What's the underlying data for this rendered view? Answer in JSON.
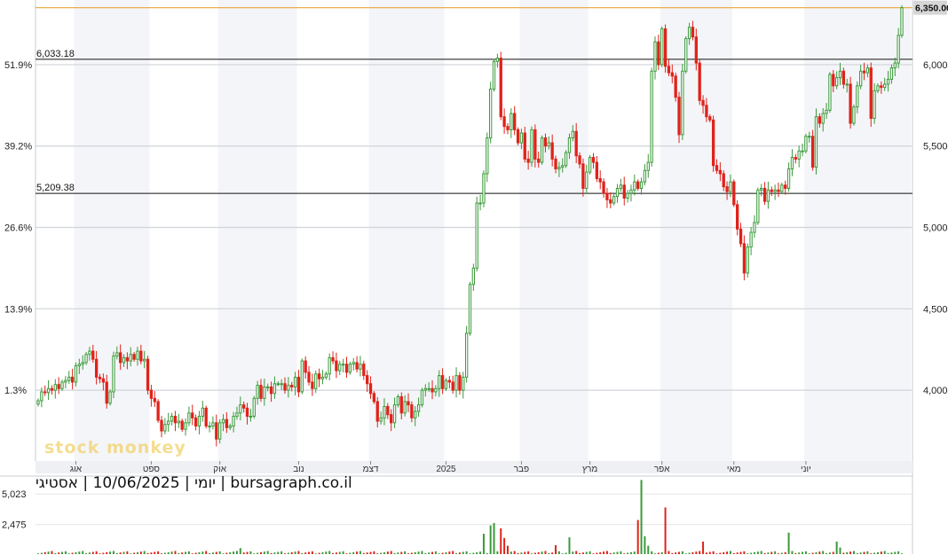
{
  "chart_data": {
    "type": "candlestick",
    "title": "",
    "caption": "יומי | 10/06/2025 | אסטיגי | bursagraph.co.il",
    "watermark": "stock monkey",
    "price_axis": {
      "ticks": [
        4000,
        4500,
        5000,
        5500,
        6000
      ],
      "tick_labels": [
        "4,000",
        "4,500",
        "5,000",
        "5,500",
        "6,000"
      ],
      "range": [
        3565,
        6370
      ]
    },
    "percent_axis": {
      "ticks": [
        1.3,
        13.9,
        26.6,
        39.2,
        51.9
      ],
      "tick_labels": [
        "1.3%",
        "13.9%",
        "26.6%",
        "39.2%",
        "51.9%"
      ]
    },
    "last_price": 6350,
    "last_price_label": "6,350.00",
    "horizontal_levels": [
      {
        "value": 6033.18,
        "label": "6,033.18"
      },
      {
        "value": 5209.38,
        "label": "5,209.38"
      }
    ],
    "months": [
      {
        "label": "אוג",
        "start_day": 11
      },
      {
        "label": "ספט",
        "start_day": 33
      },
      {
        "label": "אוק",
        "start_day": 53
      },
      {
        "label": "נוב",
        "start_day": 76
      },
      {
        "label": "דצמ",
        "start_day": 97
      },
      {
        "label": "2025",
        "start_day": 119
      },
      {
        "label": "פבר",
        "start_day": 141
      },
      {
        "label": "מרץ",
        "start_day": 161
      },
      {
        "label": "אפר",
        "start_day": 182
      },
      {
        "label": "מאי",
        "start_day": 203
      },
      {
        "label": "יוני",
        "start_day": 224
      }
    ],
    "series": {
      "name": "",
      "close": [
        3935,
        3990,
        3985,
        4010,
        4000,
        4035,
        4010,
        4050,
        4060,
        4080,
        4050,
        4150,
        4160,
        4170,
        4220,
        4240,
        4190,
        4080,
        4070,
        4050,
        3920,
        3990,
        4210,
        4230,
        4170,
        4200,
        4180,
        4220,
        4190,
        4240,
        4180,
        4190,
        4000,
        3950,
        3930,
        3815,
        3750,
        3790,
        3810,
        3840,
        3800,
        3810,
        3760,
        3800,
        3860,
        3830,
        3780,
        3840,
        3890,
        3780,
        3780,
        3800,
        3700,
        3800,
        3820,
        3770,
        3780,
        3840,
        3860,
        3910,
        3890,
        3840,
        3840,
        3950,
        4030,
        3950,
        4020,
        4020,
        3980,
        4040,
        4040,
        4040,
        4000,
        4030,
        4020,
        4080,
        3990,
        4180,
        4110,
        4050,
        4010,
        4100,
        4070,
        4080,
        4100,
        4200,
        4180,
        4120,
        4160,
        4160,
        4110,
        4160,
        4170,
        4130,
        4160,
        4090,
        4040,
        3980,
        3930,
        3810,
        3830,
        3900,
        3850,
        3800,
        3910,
        3960,
        3860,
        3930,
        3910,
        3830,
        3870,
        3910,
        4000,
        4010,
        4010,
        3990,
        4010,
        4090,
        4010,
        4060,
        4050,
        4000,
        4090,
        4000,
        4080,
        4350,
        4650,
        4750,
        5150,
        5150,
        5330,
        5550,
        5850,
        6020,
        6040,
        5680,
        5620,
        5600,
        5700,
        5600,
        5520,
        5580,
        5420,
        5400,
        5600,
        5420,
        5400,
        5550,
        5500,
        5520,
        5420,
        5360,
        5370,
        5380,
        5460,
        5550,
        5590,
        5440,
        5390,
        5240,
        5340,
        5430,
        5400,
        5300,
        5280,
        5210,
        5170,
        5150,
        5190,
        5240,
        5260,
        5180,
        5210,
        5230,
        5280,
        5240,
        5280,
        5350,
        5400,
        5960,
        6140,
        6000,
        6220,
        5990,
        5950,
        5930,
        5800,
        5570,
        5960,
        6160,
        6230,
        6170,
        6010,
        5780,
        5750,
        5680,
        5660,
        5380,
        5350,
        5330,
        5250,
        5220,
        5280,
        5140,
        4990,
        4900,
        4720,
        4880,
        4970,
        5030,
        5230,
        5240,
        5160,
        5230,
        5220,
        5230,
        5220,
        5260,
        5240,
        5360,
        5430,
        5420,
        5470,
        5470,
        5560,
        5560,
        5370,
        5680,
        5640,
        5700,
        5720,
        5940,
        5870,
        5920,
        5960,
        5880,
        5880,
        5640,
        5740,
        5870,
        5960,
        5950,
        5980,
        5670,
        5840,
        5870,
        5860,
        5880,
        5910,
        5980,
        6010,
        6180,
        6350
      ],
      "day_count": 228
    },
    "volume_axis": {
      "ticks": [
        2475,
        5023
      ],
      "tick_labels": [
        "2,475",
        "5,023"
      ]
    },
    "volume_spikes": [
      {
        "day": 59,
        "value": 500
      },
      {
        "day": 130,
        "value": 1700
      },
      {
        "day": 132,
        "value": 2400
      },
      {
        "day": 133,
        "value": 2600
      },
      {
        "day": 135,
        "value": 2150
      },
      {
        "day": 136,
        "value": 1350
      },
      {
        "day": 137,
        "value": 700
      },
      {
        "day": 151,
        "value": 750
      },
      {
        "day": 155,
        "value": 1400
      },
      {
        "day": 175,
        "value": 2850
      },
      {
        "day": 176,
        "value": 6200
      },
      {
        "day": 177,
        "value": 1500
      },
      {
        "day": 178,
        "value": 700
      },
      {
        "day": 183,
        "value": 3900
      },
      {
        "day": 194,
        "value": 1050
      },
      {
        "day": 219,
        "value": 1800
      },
      {
        "day": 233,
        "value": 1050
      },
      {
        "day": 234,
        "value": 550
      }
    ],
    "grid": true,
    "colors": {
      "up": "#3a9a3a",
      "down": "#e0231b",
      "grid": "#d0d4da",
      "band": "#f4f5f8",
      "last": "#e8a33a"
    }
  }
}
